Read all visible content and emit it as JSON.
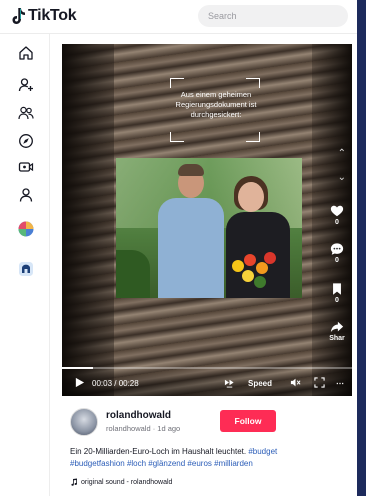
{
  "header": {
    "logo_text": "TikTok",
    "search_placeholder": "Search"
  },
  "sidebar": {
    "items": [
      {
        "icon": "home-icon"
      },
      {
        "icon": "following-icon"
      },
      {
        "icon": "friends-icon"
      },
      {
        "icon": "explore-icon"
      },
      {
        "icon": "live-icon"
      },
      {
        "icon": "profile-icon"
      },
      {
        "icon": "creator-avatar-icon"
      },
      {
        "icon": "app-icon"
      }
    ]
  },
  "video": {
    "caption_text": "Aus einem geheimen Regierungsdokument ist durchgesickert:",
    "time": "00:03 / 00:28",
    "progress": 0.107,
    "speed_label": "Speed",
    "actions": [
      {
        "icon": "like-icon",
        "count": "0"
      },
      {
        "icon": "comment-icon",
        "count": "0"
      },
      {
        "icon": "bookmark-icon",
        "count": "0"
      },
      {
        "icon": "share-icon",
        "count": "Shar"
      }
    ]
  },
  "post": {
    "username": "rolandhowald",
    "handle_line": "rolandhowald · 1d ago",
    "follow_label": "Follow",
    "description": "Ein 20-Milliarden-Euro-Loch im Haushalt leuchtet.",
    "hashtags_line1": "#budget",
    "hashtags_line2": "#budgetfashion #loch #glänzend #euros #milliarden",
    "sound": "original sound - rolandhowald"
  },
  "colors": {
    "accent": "#fe2c55",
    "hashtag": "#2b5db8",
    "text": "#161823"
  }
}
